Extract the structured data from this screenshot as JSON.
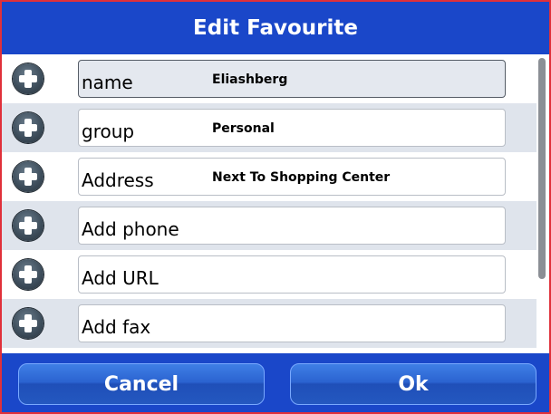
{
  "window": {
    "title": "Edit Favourite"
  },
  "fields": [
    {
      "label": "name",
      "value": "Eliashberg"
    },
    {
      "label": "group",
      "value": "Personal"
    },
    {
      "label": "Address",
      "value": "Next To Shopping Center"
    },
    {
      "label": "Add phone",
      "value": ""
    },
    {
      "label": "Add URL",
      "value": ""
    },
    {
      "label": "Add fax",
      "value": ""
    }
  ],
  "footer": {
    "cancel_label": "Cancel",
    "ok_label": "Ok"
  },
  "icons": {
    "row_add": "plus-circle-icon"
  },
  "colors": {
    "header_bg": "#1a47c9",
    "button_bg": "#2b63d0",
    "border_accent": "#e0303a"
  }
}
